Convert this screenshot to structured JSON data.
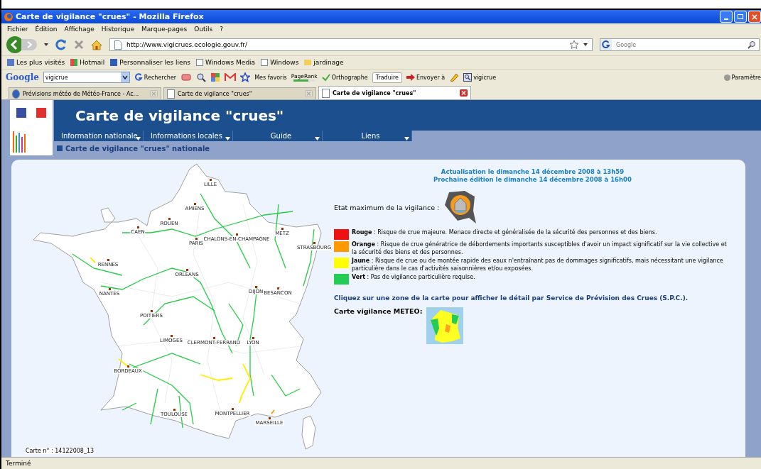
{
  "window": {
    "title": "Carte de vigilance \"crues\" - Mozilla Firefox"
  },
  "menu": [
    "Fichier",
    "Édition",
    "Affichage",
    "Historique",
    "Marque-pages",
    "Outils",
    "?"
  ],
  "address": {
    "value": "http://www.vigicrues.ecologie.gouv.fr/"
  },
  "search": {
    "placeholder": "Google"
  },
  "bookmarks": [
    {
      "label": "Les plus visités",
      "kind": "smart"
    },
    {
      "label": "Hotmail",
      "kind": "windows"
    },
    {
      "label": "Personnaliser les liens",
      "kind": "m"
    },
    {
      "label": "Windows Media",
      "kind": "page"
    },
    {
      "label": "Windows",
      "kind": "page"
    },
    {
      "label": "jardinage",
      "kind": "folder"
    }
  ],
  "google_toolbar": {
    "logo": "Google",
    "query": "vigicrue",
    "search_label": "Rechercher",
    "favorites": "Mes favoris",
    "pagerank": "PageRank",
    "spelling": "Orthographe",
    "translate": "Traduire",
    "send": "Envoyer à",
    "highlight": "vigicrue",
    "settings": "Paramètre"
  },
  "tabs": [
    {
      "label": "Prévisions météo de Météo-France - Ac...",
      "selected": false
    },
    {
      "label": "Carte de vigilance \"crues\"",
      "selected": false
    },
    {
      "label": "Carte de vigilance \"crues\"",
      "selected": true
    }
  ],
  "site": {
    "title": "Carte de vigilance \"crues\"",
    "nav": [
      "Information nationale",
      "Informations locales",
      "Guide",
      "Liens"
    ],
    "breadcrumb": "Carte de vigilance \"crues\" nationale"
  },
  "map": {
    "caption": "Carte n° : 14122008_13",
    "cities": [
      "LILLE",
      "AMIENS",
      "ROUEN",
      "CAEN",
      "PARIS",
      "CHALONS-EN-CHAMPAGNE",
      "METZ",
      "STRASBOURG",
      "RENNES",
      "ORLEANS",
      "NANTES",
      "DIJON",
      "BESANCON",
      "POITIERS",
      "LIMOGES",
      "CLERMONT-FERRAND",
      "LYON",
      "BORDEAUX",
      "TOULOUSE",
      "MONTPELLIER",
      "MARSEILLE"
    ]
  },
  "info": {
    "update": "Actualisation le dimanche 14 décembre 2008 à 13h59",
    "next": "Prochaine édition le dimanche 14 décembre 2008 à 16h00",
    "max_state": "Etat maximum de la vigilance :",
    "legend": [
      {
        "text": "**Rouge** : Risque de crue majeure. Menace directe et généralisée de la sécurité des personnes et des biens.",
        "color": "#ee1111"
      },
      {
        "text": "**Orange** : Risque de crue génératrice de débordements importants susceptibles d'avoir un impact significatif sur la vie collective et la sécurité des biens et des personnes.",
        "color": "#ff9900"
      },
      {
        "text": "**Jaune** : Risque de crue ou de montée rapide des eaux n'entraînant pas de dommages significatifs, mais nécessitant une vigilance particulière dans le cas d'activités saisonnières et/ou exposées.",
        "color": "#ffff00"
      },
      {
        "text": "**Vert** : Pas de vigilance particulière requise.",
        "color": "#22cc55"
      }
    ],
    "instruction": "Cliquez sur une zone de la carte pour afficher le détail par Service de Prévision des Crues (S.P.C.).",
    "meteo_label": "Carte vigilance METEO:"
  },
  "status_bar": "Terminé"
}
